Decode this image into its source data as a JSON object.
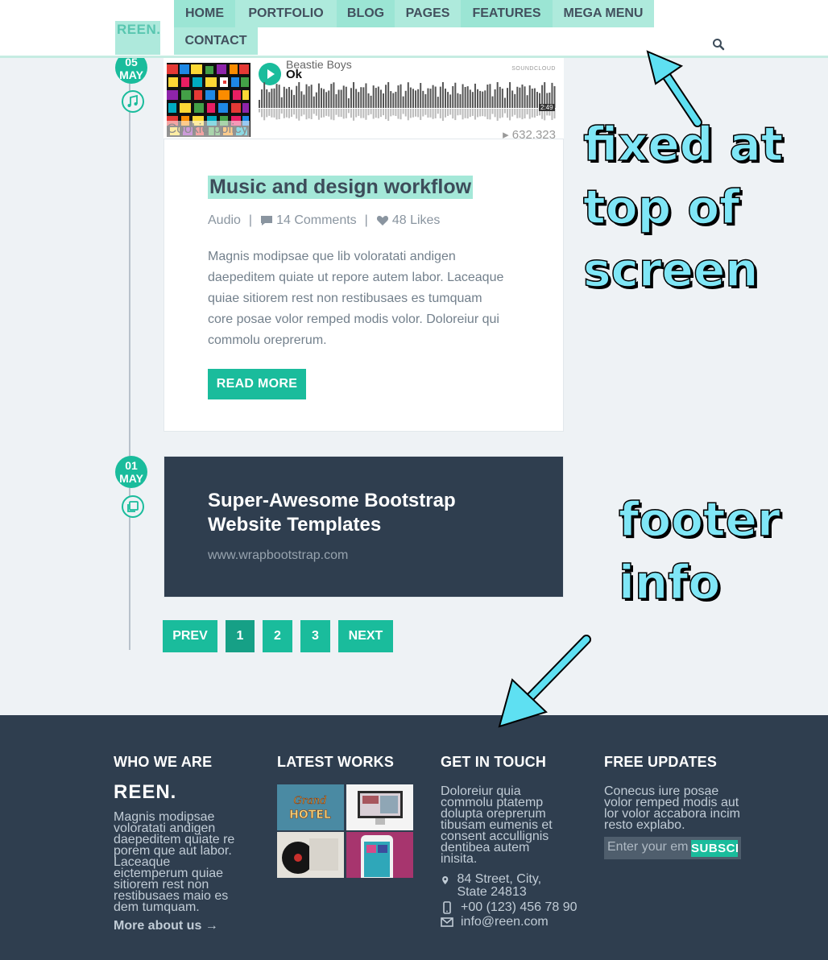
{
  "colors": {
    "accent": "#1abc9c",
    "header_bg": "#ffffff",
    "footer_bg": "#2f3e4f",
    "page_bg": "#eef2f5",
    "annotation": "#7fe6f6"
  },
  "header": {
    "logo": "REEN.",
    "nav": [
      "HOME",
      "PORTFOLIO",
      "BLOG",
      "PAGES",
      "FEATURES",
      "MEGA MENU",
      "CONTACT"
    ],
    "search_icon": "search-icon"
  },
  "posts": [
    {
      "date_day": "05",
      "date_month": "MAY",
      "type_icon": "music-note-icon",
      "embed": {
        "artist": "Beastie Boys",
        "track": "Ok",
        "provider": "SOUNDCLOUD",
        "duration": "2:49",
        "plays": "▸ 632,323"
      },
      "cookie_notice": "Cookie policy",
      "title": "Music and design workflow",
      "category": "Audio",
      "comments": "14 Comments",
      "likes": "48 Likes",
      "body": "Magnis modipsae que lib voloratati andigen daepeditem quiate ut repore autem labor. Laceaque quiae sitiorem rest non restibusaes es tumquam core posae volor remped modis volor. Doloreiur qui commolu oreprerum.",
      "read_more": "READ MORE"
    },
    {
      "date_day": "01",
      "date_month": "MAY",
      "type_icon": "gallery-icon",
      "title": "Super-Awesome Bootstrap Website Templates",
      "url": "www.wrapbootstrap.com"
    }
  ],
  "pagination": {
    "prev": "PREV",
    "pages": [
      "1",
      "2",
      "3"
    ],
    "next": "NEXT",
    "current": "1"
  },
  "annotations": {
    "header_note_lines": [
      "fixed at",
      "top of",
      "screen"
    ],
    "footer_note_lines": [
      "footer",
      "info"
    ]
  },
  "footer": {
    "who": {
      "heading": "WHO WE ARE",
      "logo": "REEN.",
      "text": "Magnis modipsae voloratati andigen daepeditem quiate re porem que aut labor. Laceaque eictemperum quiae sitiorem rest non restibusaes maio es dem tumquam.",
      "more": "More about us →"
    },
    "works": {
      "heading": "LATEST WORKS",
      "thumbs": [
        "Grand Hotel",
        "Website mockup",
        "Vinyl Record PSD Mockup",
        "Phone app mockup"
      ],
      "thumb_label_1": "Grand",
      "thumb_label_2": "HOTEL"
    },
    "contact": {
      "heading": "GET IN TOUCH",
      "text": "Doloreiur quia commolu ptatemp dolupta orepre­rum tibusam eumenis et consent accullignis dentibea autem inisita.",
      "address": "84 Street, City, State 24813",
      "phone": "+00 (123) 456 78 90",
      "email": "info@reen.com"
    },
    "updates": {
      "heading": "FREE UPDATES",
      "text": "Conecus iure posae volor remped modis aut lor volor accabora incim resto explabo.",
      "placeholder": "Enter your email",
      "button": "SUBSCRIBE"
    }
  }
}
